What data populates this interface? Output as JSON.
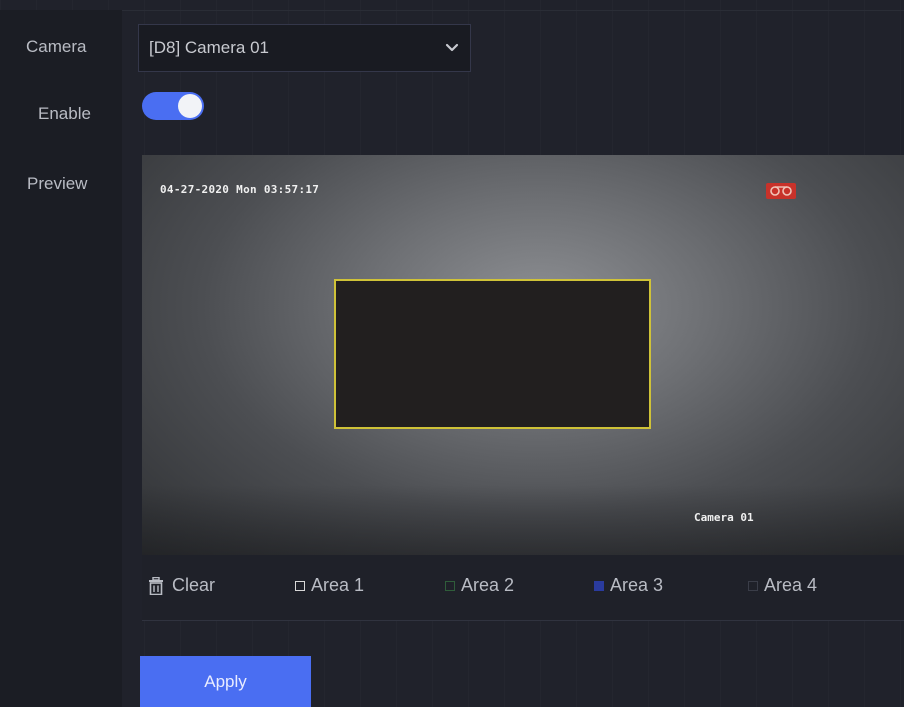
{
  "form": {
    "camera_label": "Camera",
    "camera_value": "[D8] Camera 01",
    "enable_label": "Enable",
    "enable_state": true,
    "preview_label": "Preview"
  },
  "preview": {
    "osd_timestamp": "04-27-2020 Mon 03:57:17",
    "osd_camera_name": "Camera 01"
  },
  "toolbar": {
    "clear_label": "Clear",
    "areas": [
      {
        "label": "Area 1",
        "color": "#d8d8d8"
      },
      {
        "label": "Area 2",
        "color": "#2f5d3a"
      },
      {
        "label": "Area 3",
        "color": "#2a3b9e"
      },
      {
        "label": "Area 4",
        "color": "#3a3d48"
      }
    ]
  },
  "actions": {
    "apply_label": "Apply"
  },
  "colors": {
    "accent": "#4a6ef2",
    "mask_border": "#cfc238",
    "background": "#20222b"
  }
}
